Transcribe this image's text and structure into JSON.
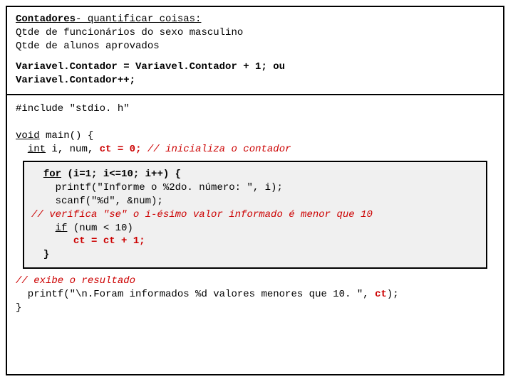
{
  "top": {
    "title_b_u": "Contadores",
    "title_rest_u": "- quantificar coisas:",
    "line2": "Qtde de funcionários do sexo masculino",
    "line3": "Qtde de alunos aprovados",
    "expr1": "Variavel.Contador = Variavel.Contador + 1;",
    "ou": "ou",
    "expr2": "Variavel.Contador++;"
  },
  "code": {
    "l1_a": "#include \"stdio. h\"",
    "l2_void": "void",
    "l2_rest": " main() {",
    "l3_pad": "  ",
    "l3_int": "int",
    "l3_mid": " i, num, ",
    "l3_ct": "ct = 0;",
    "l3_comment": " // inicializa o contador",
    "inner": {
      "l1_pad": "  ",
      "l1_for": "for",
      "l1_rest": " (i=1; i<=10; i++) {",
      "l2": "    printf(\"Informe o %2do. número: \", i);",
      "l3": "    scanf(\"%d\", &num);",
      "l4": "// verifica \"se\" o i-ésimo valor informado é menor que 10",
      "l5_pad": "    ",
      "l5_if": "if",
      "l5_rest": " (num < 10)",
      "l6_pad": "       ",
      "l6_ct": "ct = ct + 1;",
      "l7": "  }"
    },
    "l_end_comment": "// exibe o resultado",
    "l_printf_a": "  printf(\"\\n.Foram informados %d valores menores que 10. \", ",
    "l_printf_ct": "ct",
    "l_printf_b": ");",
    "l_close": "}"
  }
}
